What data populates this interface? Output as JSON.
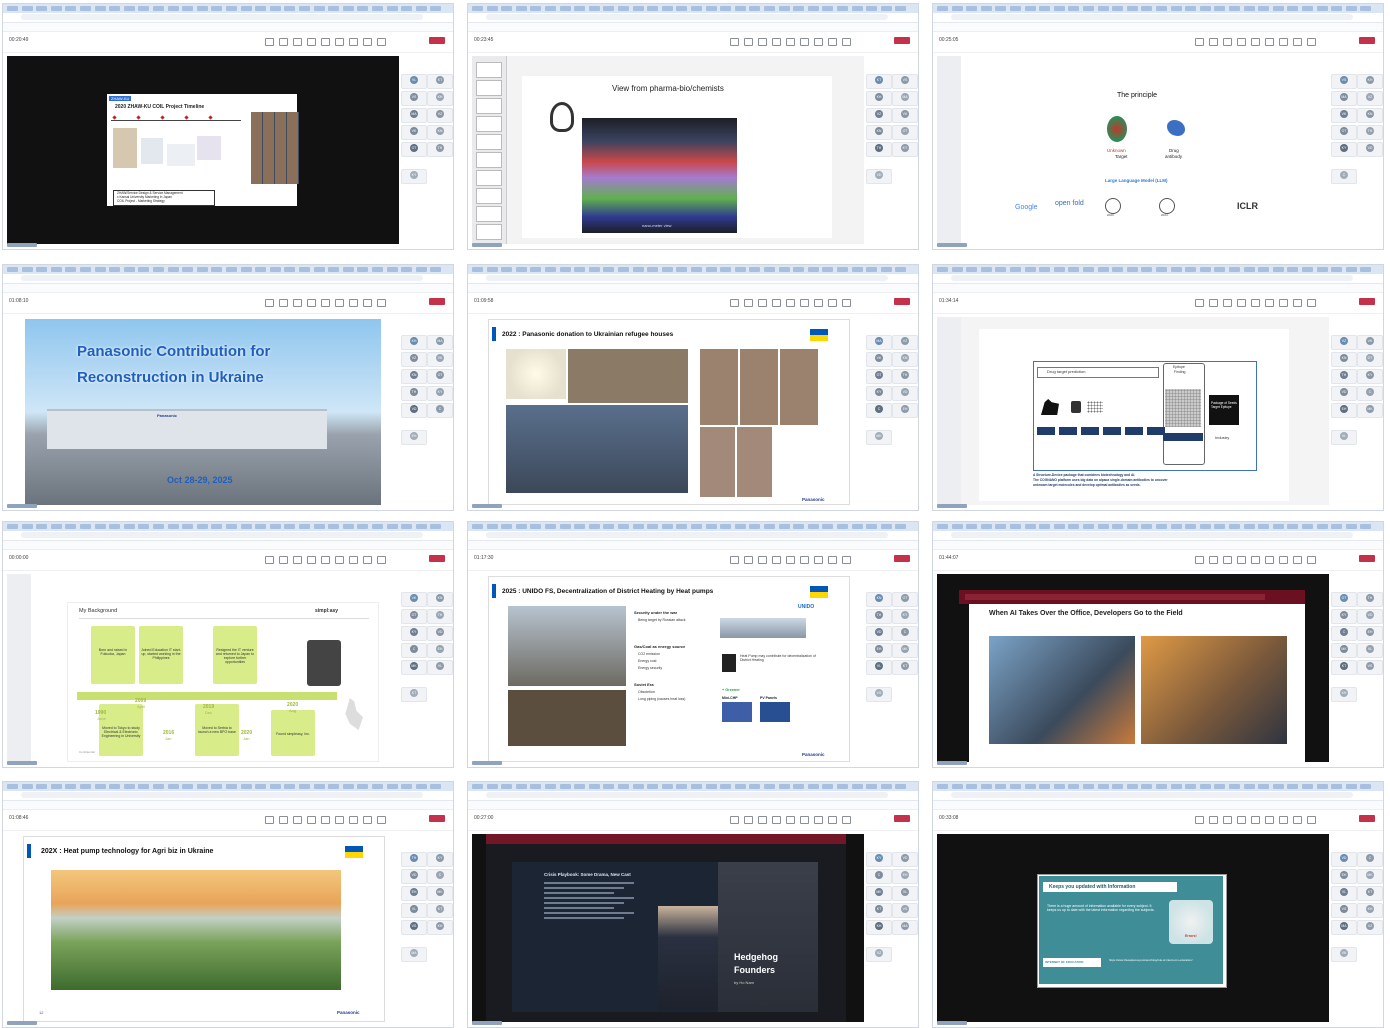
{
  "tiles": [
    {
      "timer": "00:20:49",
      "slide": {
        "tag": "ZHAW-KU",
        "title": "2020 ZHAW-KU COIL Project Timeline",
        "footer1": "ZHAW/Service Design & Service Management",
        "footer2": "x Kansai University Marketing in Japan",
        "footer3": "COIL Project - Marketing Strategy"
      }
    },
    {
      "timer": "00:23:45",
      "slide": {
        "title": "View from pharma-bio/chemists",
        "caption": "nano-meter view"
      }
    },
    {
      "timer": "00:25:05",
      "slide": {
        "title": "The principle",
        "unknown": "Unknown",
        "target": "Target",
        "drug": "Drug",
        "antibody": "antibody",
        "llm": "Large Language Model (LLM)",
        "google": "Google",
        "openfold": "open fold",
        "neurips1": "2023",
        "neurips2": "2024",
        "iclr": "ICLR"
      }
    },
    {
      "timer": "01:08:10",
      "slide": {
        "title1": "Panasonic Contribution for",
        "title2": "Reconstruction in Ukraine",
        "building": "Panasonic",
        "date": "Oct 28-29, 2025"
      }
    },
    {
      "timer": "01:09:58",
      "slide": {
        "title": "2022 : Panasonic donation to Ukrainian refugee houses",
        "brand": "Panasonic"
      }
    },
    {
      "timer": "01:34:14",
      "slide": {
        "left": "Drug target prediction",
        "right1": "Epitope",
        "right2": "Finding",
        "pkg": "Package of Seeds Target Epitope",
        "industry": "Industry",
        "desc1": "A Structure-Device package that combines biotechnology and AI.",
        "desc2": "The COGNANO platform uses big data on alpaca single-domain antibodies to uncover",
        "desc3": "unknown target molecules and develop optimal antibodies as seeds."
      }
    },
    {
      "timer": "00:00:00",
      "slide": {
        "title": "My Background",
        "brand": "simpl:asy",
        "items": [
          {
            "text": "Born and raised in Fukuoka, Japan",
            "year": "1990",
            "month": "June"
          },
          {
            "text": "Joined Education IT start-up, started working in the Philippines",
            "year": "2009",
            "month": "April"
          },
          {
            "text": "Moved to Tokyo to study Electrical & Electronic Engineering in University",
            "year": "2016",
            "month": "Jan"
          },
          {
            "text": "Resigned the IT venture and returned to Japan to explore further opportunities",
            "year": "2019",
            "month": "Dec"
          },
          {
            "text": "Moved to Serbia to launch a new BPO base",
            "year": "2020",
            "month": "Jan"
          },
          {
            "text": "Found simpleasy, Inc.",
            "year": "2020",
            "month": "Aug"
          }
        ],
        "footer": "Confidential"
      }
    },
    {
      "timer": "01:17:30",
      "slide": {
        "title": "2025 : UNIDO FS, Decentralization of District Heating by Heat pumps",
        "unido": "UNIDO",
        "h1": "Security under the war",
        "b1": [
          "Being target by Russian attack"
        ],
        "h2": "Gas/Coal as energy source",
        "b2": [
          "CO2 emission",
          "Energy cost",
          "Energy security"
        ],
        "h3": "Soviet Era",
        "b3": [
          "Obsoletion",
          "Long piping (causes heat loss)"
        ],
        "hp": "Heat Pump may contribute for decentralization of District Heating",
        "greener": "+ Greener",
        "mini": "Mini-CHP",
        "pv": "PV Panels",
        "brand": "Panasonic"
      }
    },
    {
      "timer": "01:44:07",
      "slide": {
        "title": "When AI Takes Over the Office, Developers Go to the Field"
      }
    },
    {
      "timer": "01:08:46",
      "slide": {
        "title": "202X : Heat pump technology for Agri biz in Ukraine",
        "brand": "Panasonic",
        "page": "12"
      }
    },
    {
      "timer": "00:27:00",
      "slide": {
        "title": "Crisis Playbook: Some Drama, New Cast",
        "hh1": "Hedgehog",
        "hh2": "Founders",
        "by": "by Ho Nam"
      }
    },
    {
      "timer": "00:33:08",
      "slide": {
        "title": "Keeps you updated with Information",
        "body": "There is a huge amount of information available for every subject. It keeps us up to date with the latest information regarding the subjects.",
        "btn": "INTERNET OF EDUCATION",
        "url": "https://www.thesapienceyoutravel.blog/role-of-internet-in-education/",
        "errors": "Errors!"
      }
    }
  ],
  "participants": [
    "VL",
    "KT",
    "VS",
    "KH",
    "MA",
    "VZ",
    "VK",
    "KN",
    "OT",
    "TH",
    "KY",
    "VD",
    "C",
    "EH",
    "MK"
  ],
  "colors": {
    "teams_leave": "#c4314b",
    "ukraine_blue": "#0057b7",
    "ukraine_yellow": "#ffd700",
    "panasonic_title": "#1f5fbf",
    "timeline_green": "#c8e06f",
    "keeps_teal": "#3e8d97"
  }
}
